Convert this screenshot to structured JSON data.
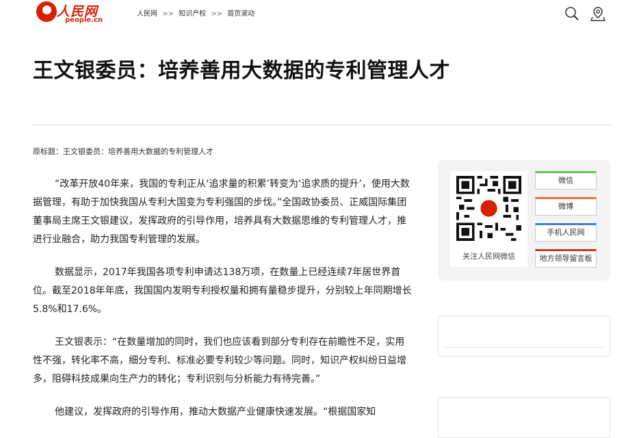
{
  "header": {
    "logo": {
      "cn": "人民网",
      "en": "people.cn"
    },
    "breadcrumb": [
      "人民网",
      "知识产权",
      "首页滚动"
    ],
    "breadcrumb_sep": ">>",
    "icons": [
      "search-icon",
      "location-icon"
    ]
  },
  "article": {
    "title": "王文银委员：培养善用大数据的专利管理人才",
    "original_title": "原标题：王文银委员：培养善用大数据的专利管理人才",
    "paragraphs": [
      "“改革开放40年来，我国的专利正从‘追求量的积累’转变为‘追求质的提升’，使用大数据管理，有助于加快我国从专利大国变为专利强国的步伐。”全国政协委员、正威国际集团董事局主席王文银建议，发挥政府的引导作用，培养具有大数据思维的专利管理人才，推进行业融合，助力我国专利管理的发展。",
      "数据显示，2017年我国各项专利申请达138万项，在数量上已经连续7年居世界首位。截至2018年年底，我国国内发明专利授权量和拥有量稳步提升，分别较上年同期增长5.8%和17.6%。",
      "王文银表示：“在数量增加的同时，我们也应该看到部分专利存在前瞻性不足，实用性不强，转化率不高，细分专利、标准必要专利较少等问题。同时，知识产权纠纷日益增多，阻碍科技成果向生产力的转化；专利识别与分析能力有待完善。”",
      "他建议，发挥政府的引导作用，推动大数据产业健康快速发展。“根据国家知"
    ]
  },
  "sidebar": {
    "qr_caption": "关注人民网微信",
    "buttons": [
      {
        "label": "微信",
        "color": "#6cbf5a"
      },
      {
        "label": "微博",
        "color": "#e8733c"
      },
      {
        "label": "手机人民网",
        "color": "#4a7fc1"
      },
      {
        "label": "地方领导留言板",
        "color": "#c0392b"
      }
    ]
  },
  "colors": {
    "brand": "#d81e06"
  }
}
